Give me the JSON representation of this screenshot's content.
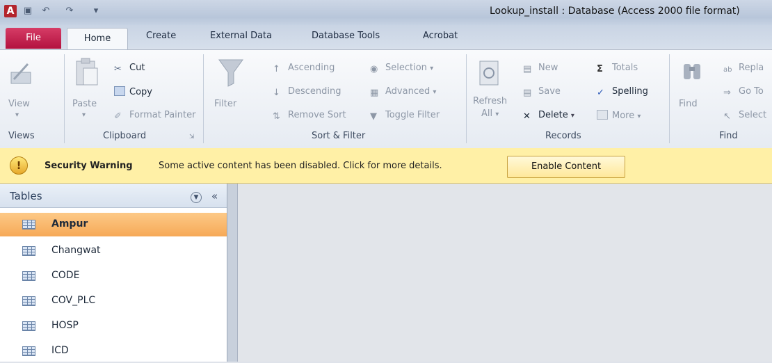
{
  "window": {
    "app_icon": "A",
    "title": "Lookup_install : Database (Access 2000 file format)"
  },
  "quick_access": [
    "save-icon",
    "undo-icon",
    "redo-icon",
    "customize-icon"
  ],
  "tabs": [
    {
      "label": "File"
    },
    {
      "label": "Home"
    },
    {
      "label": "Create"
    },
    {
      "label": "External Data"
    },
    {
      "label": "Database Tools"
    },
    {
      "label": "Acrobat"
    }
  ],
  "ribbon": {
    "views": {
      "view_label": "View",
      "group_label": "Views"
    },
    "clipboard": {
      "paste_label": "Paste",
      "cut_label": "Cut",
      "copy_label": "Copy",
      "format_painter_label": "Format Painter",
      "group_label": "Clipboard"
    },
    "sort_filter": {
      "filter_label": "Filter",
      "ascending_label": "Ascending",
      "descending_label": "Descending",
      "remove_sort_label": "Remove Sort",
      "selection_label": "Selection",
      "advanced_label": "Advanced",
      "toggle_filter_label": "Toggle Filter",
      "group_label": "Sort & Filter"
    },
    "records": {
      "refresh_label": "Refresh",
      "refresh_all_label": "All",
      "new_label": "New",
      "save_label": "Save",
      "delete_label": "Delete",
      "totals_label": "Totals",
      "spelling_label": "Spelling",
      "more_label": "More",
      "group_label": "Records"
    },
    "find": {
      "find_label": "Find",
      "replace_label": "Repla",
      "goto_label": "Go To",
      "select_label": "Select",
      "group_label": "Find"
    }
  },
  "security_bar": {
    "title": "Security Warning",
    "message": "Some active content has been disabled. Click for more details.",
    "button_label": "Enable Content"
  },
  "nav_pane": {
    "title": "Tables",
    "collapse_glyph": "«",
    "items": [
      {
        "label": "Ampur",
        "selected": true
      },
      {
        "label": "Changwat"
      },
      {
        "label": "CODE"
      },
      {
        "label": "COV_PLC"
      },
      {
        "label": "HOSP"
      },
      {
        "label": "ICD"
      }
    ]
  },
  "colors": {
    "file_tab": "#c1184a",
    "security_bar": "#fff0a6",
    "selected_item": "#f8b56a"
  }
}
